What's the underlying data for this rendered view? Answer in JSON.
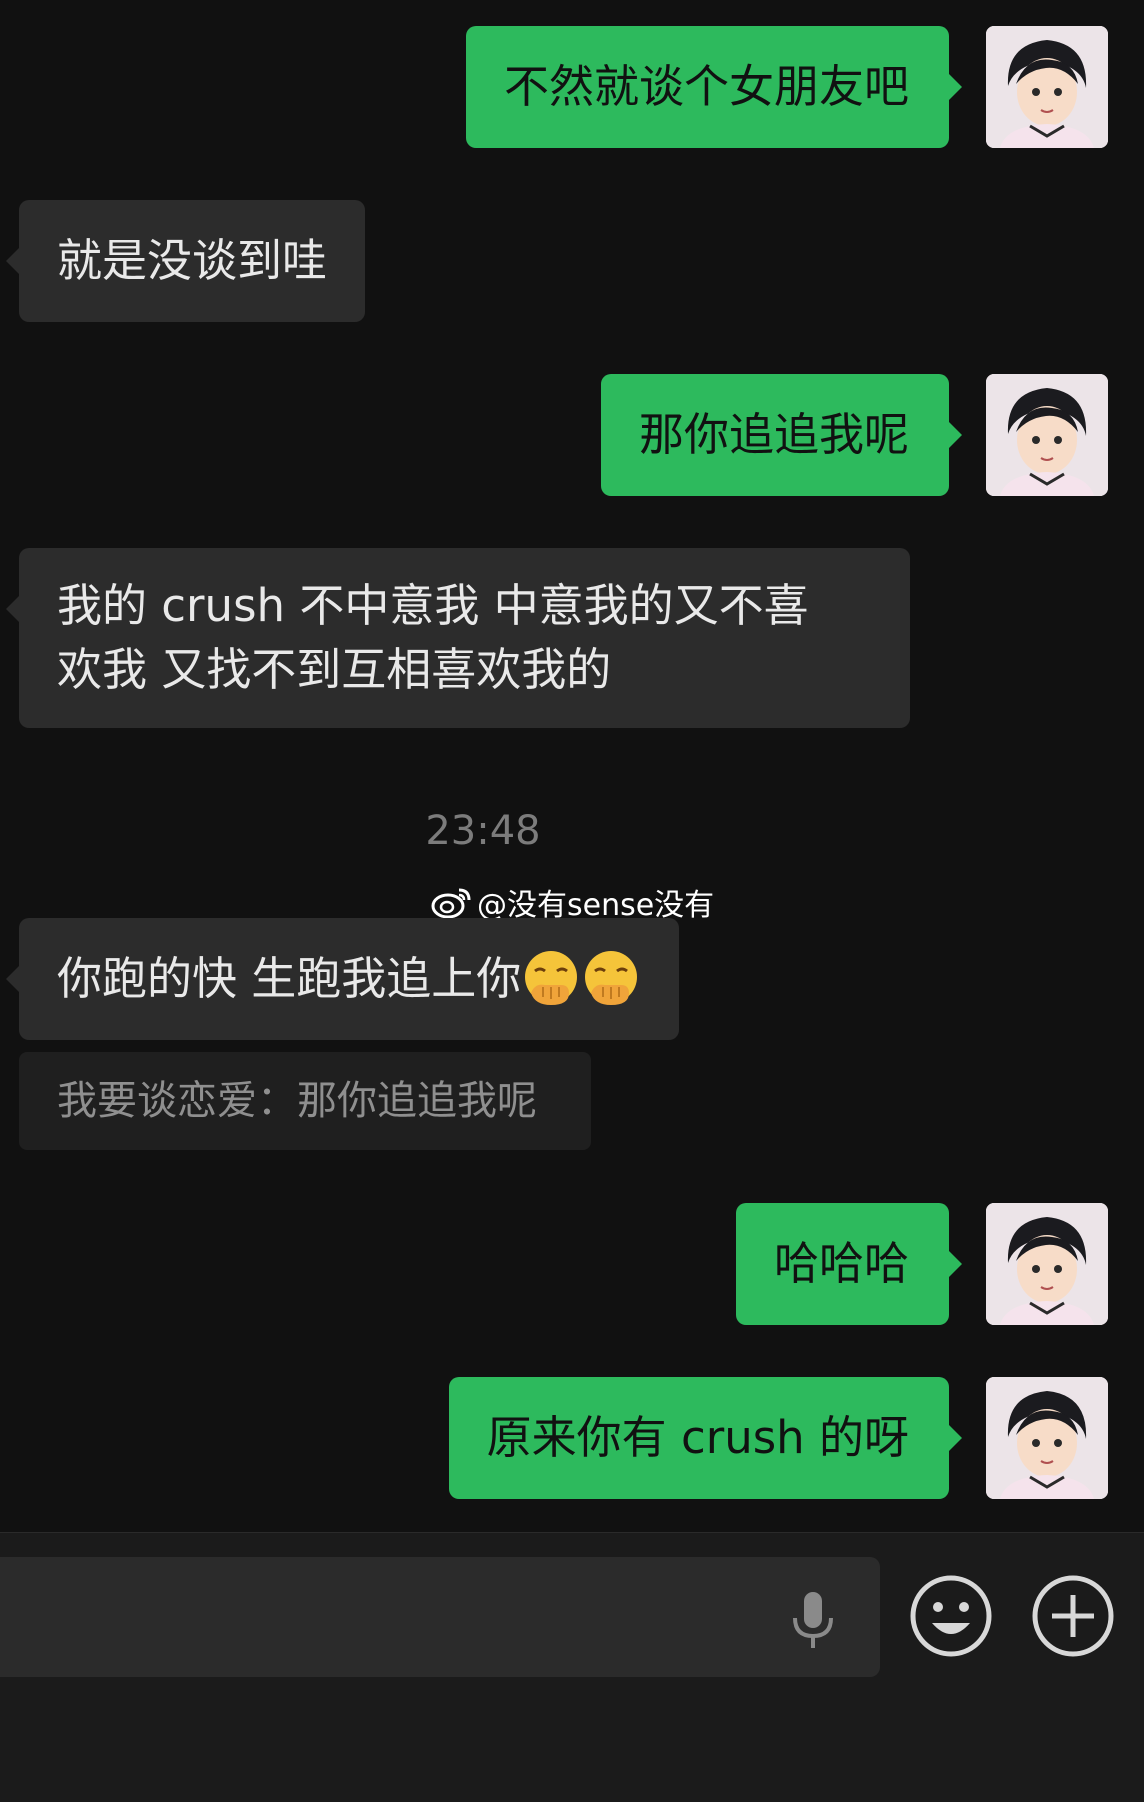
{
  "messages": [
    {
      "side": "out",
      "text": "不然就谈个女朋友吧"
    },
    {
      "side": "in",
      "text": "就是没谈到哇"
    },
    {
      "side": "out",
      "text": "那你追追我呢"
    },
    {
      "side": "in",
      "lines": [
        "我的 crush 不中意我 中意我的又不喜",
        "欢我 又找不到互相喜欢我的"
      ]
    },
    {
      "side": "in",
      "text": "你跑的快 生跑我追上你 "
    },
    {
      "side": "out",
      "text": "哈哈哈"
    },
    {
      "side": "out",
      "text": "原来你有 crush 的呀"
    }
  ],
  "timestamp": "23:48",
  "watermark": "@没有sense没有",
  "quote": "我要谈恋爱：那你追追我呢",
  "emojis": [
    "hand-over-mouth-emoji",
    "hand-over-mouth-emoji"
  ],
  "input": {
    "placeholder": ""
  },
  "icons": {
    "mic": "microphone-icon",
    "emoji": "smiley-face-icon",
    "plus": "plus-circle-icon"
  },
  "colors": {
    "background": "#111111",
    "outgoing_bubble": "#2dba5d",
    "incoming_bubble": "#2c2c2c",
    "quote_bg": "#1f1f1f",
    "timestamp": "#7c7c7c"
  }
}
